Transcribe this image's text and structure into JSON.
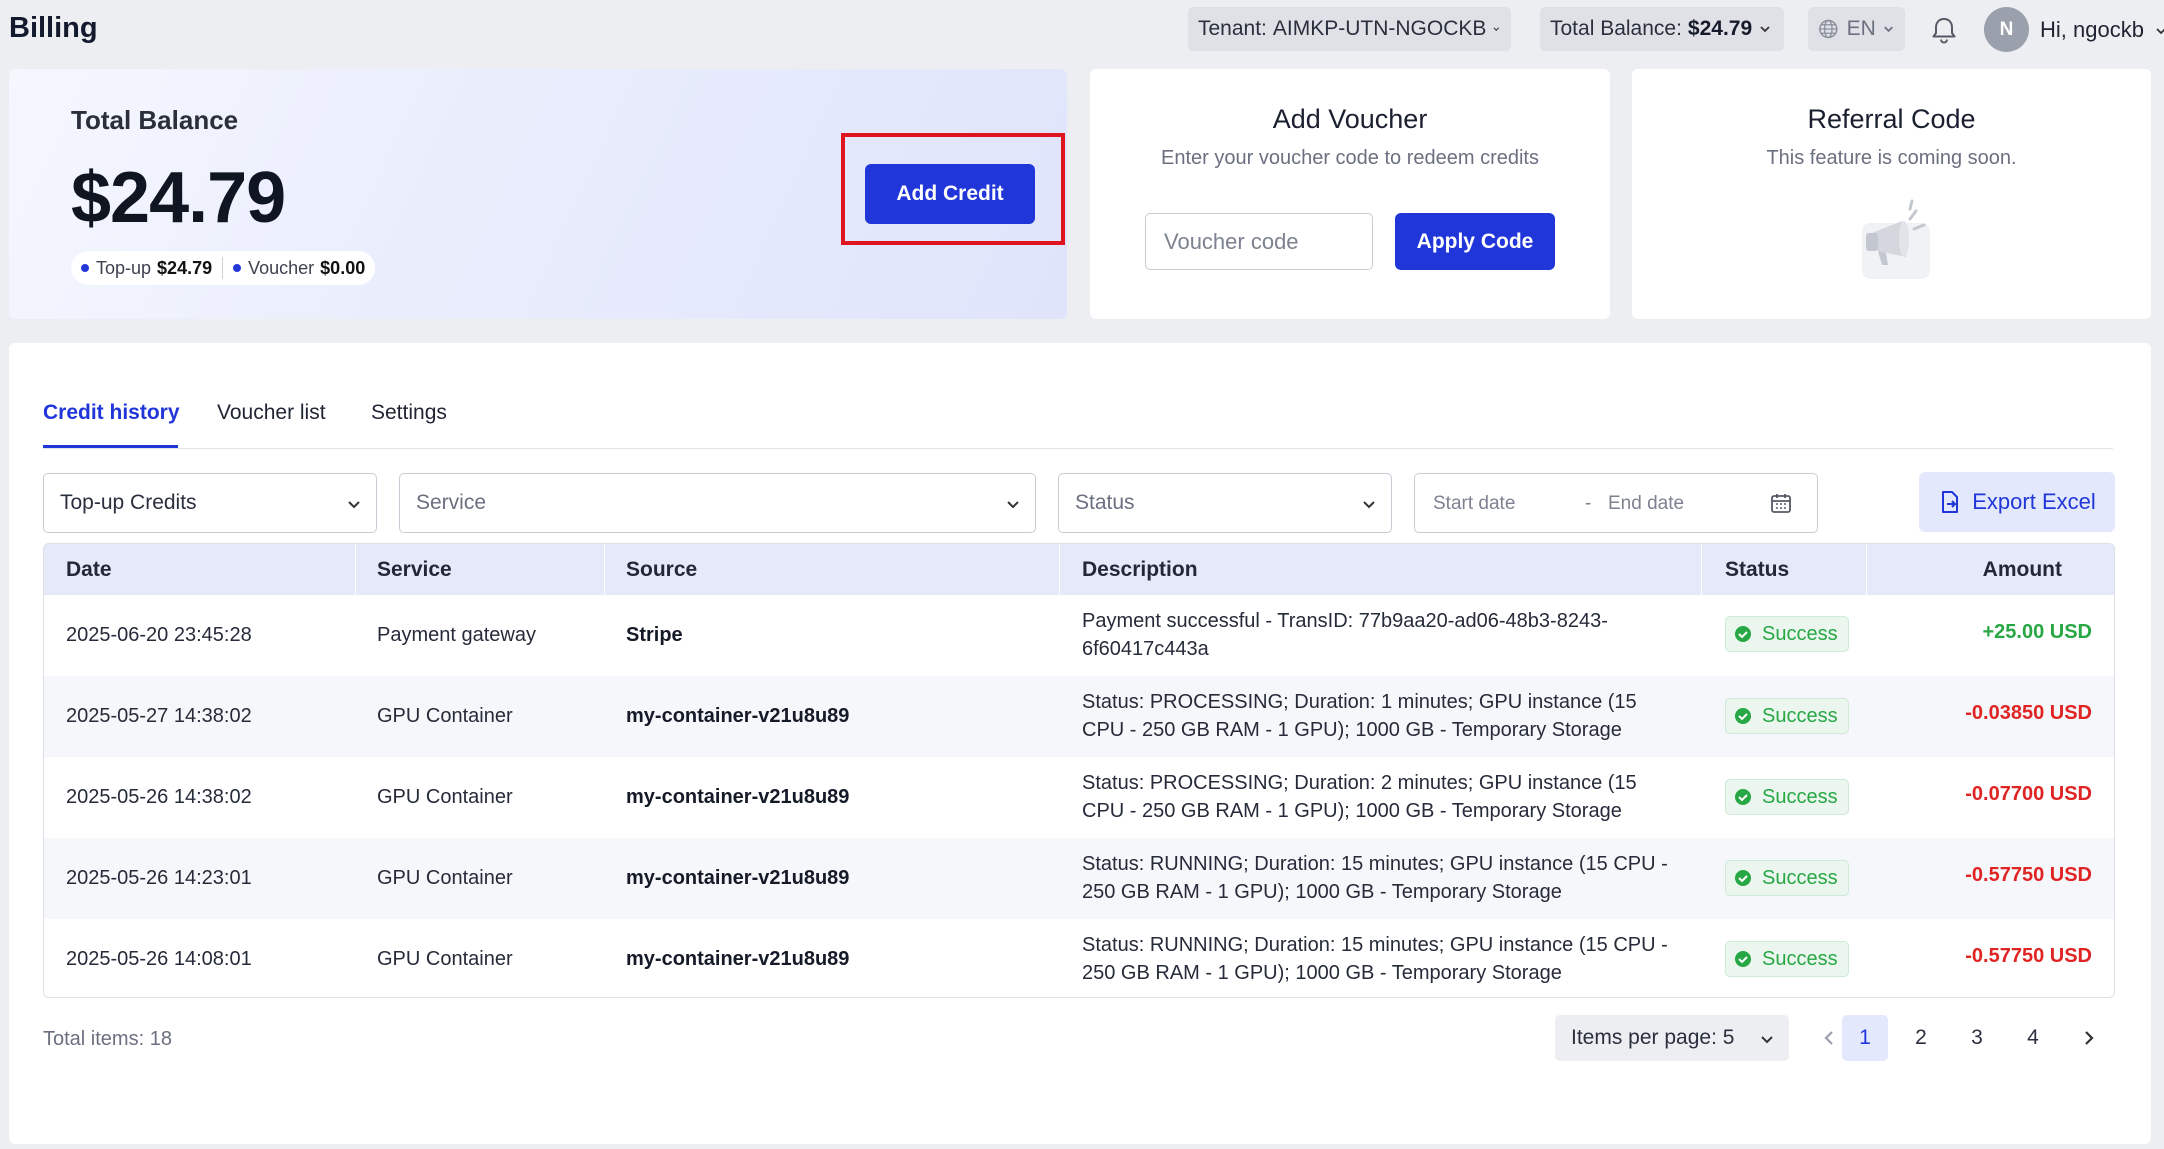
{
  "header": {
    "title": "Billing",
    "tenant_label": "Tenant:",
    "tenant_value": "AIMKP-UTN-NGOCKB",
    "balance_label": "Total Balance:",
    "balance_value": "$24.79",
    "language": "EN",
    "avatar_initial": "N",
    "greeting": "Hi, ngockb"
  },
  "balance_card": {
    "title": "Total Balance",
    "amount": "$24.79",
    "topup_label": "Top-up",
    "topup_value": "$24.79",
    "voucher_label": "Voucher",
    "voucher_value": "$0.00",
    "add_credit_label": "Add Credit"
  },
  "voucher_card": {
    "title": "Add Voucher",
    "subtitle": "Enter your voucher code to redeem credits",
    "input_placeholder": "Voucher code",
    "apply_label": "Apply Code"
  },
  "referral_card": {
    "title": "Referral Code",
    "subtitle": "This feature is coming soon."
  },
  "tabs": [
    {
      "label": "Credit history",
      "active": true
    },
    {
      "label": "Voucher list",
      "active": false
    },
    {
      "label": "Settings",
      "active": false
    }
  ],
  "filters": {
    "type_value": "Top-up Credits",
    "service_placeholder": "Service",
    "status_placeholder": "Status",
    "start_date_placeholder": "Start date",
    "range_separator": "-",
    "end_date_placeholder": "End date",
    "export_label": "Export Excel"
  },
  "table": {
    "columns": [
      "Date",
      "Service",
      "Source",
      "Description",
      "Status",
      "Amount"
    ],
    "rows": [
      {
        "date": "2025-06-20 23:45:28",
        "service": "Payment gateway",
        "source": "Stripe",
        "desc1": "Payment successful - TransID: 77b9aa20-ad06-48b3-8243-",
        "desc2": "6f60417c443a",
        "status": "Success",
        "amount": "+25.00 USD"
      },
      {
        "date": "2025-05-27 14:38:02",
        "service": "GPU Container",
        "source": "my-container-v21u8u89",
        "desc1": "Status: PROCESSING; Duration: 1 minutes; GPU instance (15",
        "desc2": "CPU - 250 GB RAM - 1 GPU); 1000 GB - Temporary Storage",
        "status": "Success",
        "amount": "-0.03850 USD"
      },
      {
        "date": "2025-05-26 14:38:02",
        "service": "GPU Container",
        "source": "my-container-v21u8u89",
        "desc1": "Status: PROCESSING; Duration: 2 minutes; GPU instance (15",
        "desc2": "CPU - 250 GB RAM - 1 GPU); 1000 GB - Temporary Storage",
        "status": "Success",
        "amount": "-0.07700 USD"
      },
      {
        "date": "2025-05-26 14:23:01",
        "service": "GPU Container",
        "source": "my-container-v21u8u89",
        "desc1": "Status: RUNNING; Duration: 15 minutes; GPU instance (15 CPU -",
        "desc2": "250 GB RAM - 1 GPU); 1000 GB - Temporary Storage",
        "status": "Success",
        "amount": "-0.57750 USD"
      },
      {
        "date": "2025-05-26 14:08:01",
        "service": "GPU Container",
        "source": "my-container-v21u8u89",
        "desc1": "Status: RUNNING; Duration: 15 minutes; GPU instance (15 CPU -",
        "desc2": "250 GB RAM - 1 GPU); 1000 GB - Temporary Storage",
        "status": "Success",
        "amount": "-0.57750 USD"
      }
    ]
  },
  "pagination": {
    "total_items": "Total items: 18",
    "per_page": "Items per page: 5",
    "pages": [
      "1",
      "2",
      "3",
      "4"
    ],
    "current_page": "1"
  },
  "colors": {
    "primary": "#2036d9",
    "success": "#28a745",
    "negative": "#e02424",
    "highlight": "#e0141e"
  },
  "icons": [
    "chevron-down-icon",
    "globe-icon",
    "bell-icon",
    "megaphone-icon",
    "calendar-icon",
    "export-icon",
    "check-circle-icon",
    "chevron-left-icon",
    "chevron-right-icon"
  ]
}
